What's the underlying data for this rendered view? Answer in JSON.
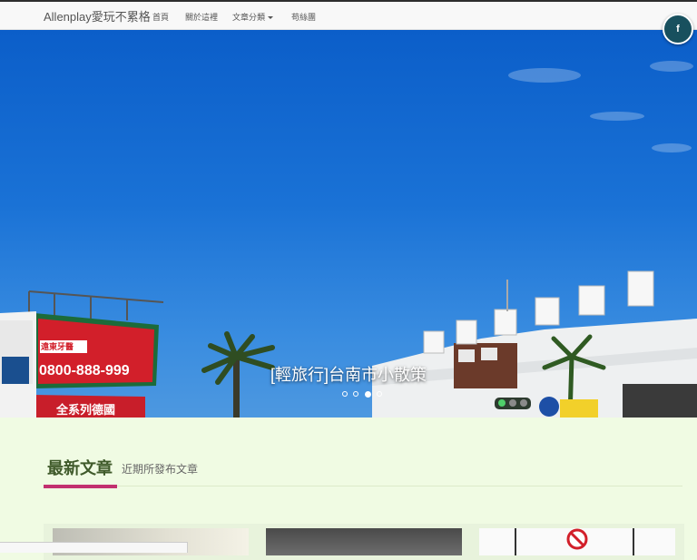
{
  "brand": "Allenplay愛玩不累格",
  "nav": {
    "home": "首頁",
    "about": "關於這裡",
    "categories": "文章分類",
    "fans": "苟絲團"
  },
  "social": {
    "facebook_icon": "f"
  },
  "hero": {
    "caption": "[輕旅行]台南市小散策",
    "slide_count": 4,
    "active_slide": 3
  },
  "sign": {
    "line1": "遠東牙醫",
    "line2": "0800-888-999",
    "line3": "全系列德國"
  },
  "section": {
    "title": "最新文章",
    "subtitle": "近期所發布文章"
  },
  "colors": {
    "accent": "#c2306f",
    "facebook": "#18505e",
    "page_bg": "#f0fbe3"
  }
}
